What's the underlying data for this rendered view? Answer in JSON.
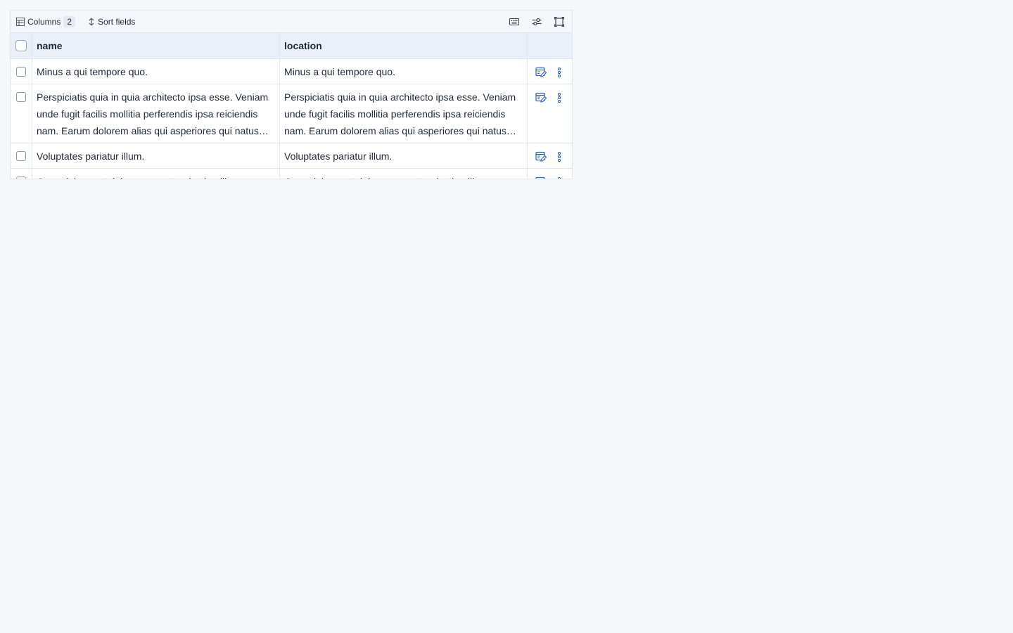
{
  "toolbar": {
    "columns_label": "Columns",
    "columns_count": "2",
    "sort_label": "Sort fields",
    "icons": [
      "keyboard-icon",
      "filter-sliders-icon",
      "fullscreen-icon"
    ]
  },
  "table": {
    "columns": [
      "name",
      "location"
    ],
    "rows": [
      {
        "name": "Minus a qui tempore quo.",
        "location": "Minus a qui tempore quo."
      },
      {
        "name": "Perspiciatis quia in quia architecto ipsa esse. Veniam unde fugit facilis mollitia perferendis ipsa reiciendis nam. Earum dolorem alias qui asperiores qui natus…",
        "location": "Perspiciatis quia in quia architecto ipsa esse. Veniam unde fugit facilis mollitia perferendis ipsa reiciendis nam. Earum dolorem alias qui asperiores qui natus…"
      },
      {
        "name": "Voluptates pariatur illum.",
        "location": "Voluptates pariatur illum."
      },
      {
        "name": "Quas dolore aut dolor neque et molestiae illum.",
        "location": "Quas dolore aut dolor neque et molestiae illum."
      }
    ]
  },
  "colors": {
    "accent": "#2f5fb3",
    "page_bg": "#f4f8fb",
    "header_bg": "#ebf0f8",
    "border": "#dfe5ec"
  }
}
